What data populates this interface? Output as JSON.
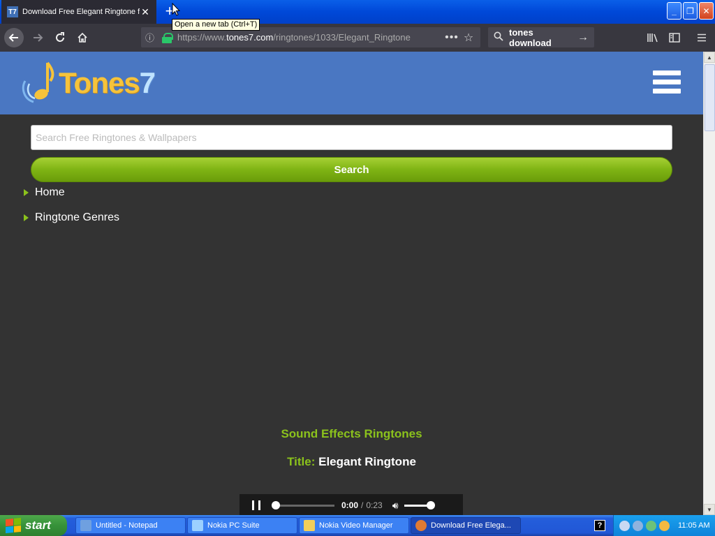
{
  "browser": {
    "tab_title": "Download Free Elegant Ringtone f",
    "favicon_text": "T7",
    "new_tab_tooltip": "Open a new tab (Ctrl+T)",
    "url_prefix": "https://www.",
    "url_domain": "tones7.com",
    "url_path": "/ringtones/1033/Elegant_Ringtone",
    "search_query": "tones download"
  },
  "site": {
    "logo_word": "Tones",
    "logo_number": "7",
    "search_placeholder": "Search Free Ringtones & Wallpapers",
    "search_button": "Search",
    "nav": [
      {
        "label": "Home"
      },
      {
        "label": "Ringtone Genres"
      }
    ],
    "category": "Sound Effects Ringtones",
    "title_label": "Title:",
    "title_value": "Elegant Ringtone"
  },
  "player": {
    "current_time": "0:00",
    "separator": "/",
    "duration": "0:23"
  },
  "taskbar": {
    "start_label": "start",
    "tasks": [
      {
        "label": "Untitled - Notepad",
        "icon_color": "#6fa0e0"
      },
      {
        "label": "Nokia PC Suite",
        "icon_color": "#9bd0ff"
      },
      {
        "label": "Nokia Video Manager",
        "icon_color": "#f2cf5b"
      },
      {
        "label": "Download Free Elega...",
        "icon_color": "#e07a32"
      }
    ],
    "help_glyph": "?",
    "clock": "11:05 AM"
  },
  "colors": {
    "header_blue": "#4a77c2",
    "accent_green": "#8bc21c",
    "page_bg": "#333333"
  }
}
